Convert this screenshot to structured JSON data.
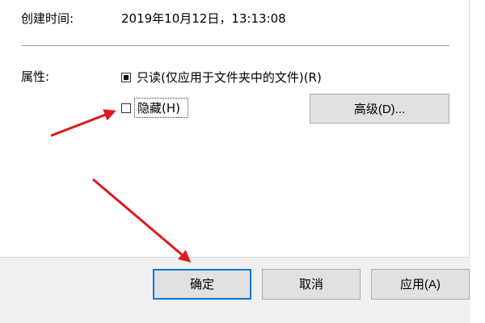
{
  "created": {
    "label": "创建时间:",
    "value": "2019年10月12日，13:13:08"
  },
  "attributes": {
    "label": "属性:",
    "readonly": {
      "label": "只读(仅应用于文件夹中的文件)(R)",
      "checked": "partial"
    },
    "hidden": {
      "label": "隐藏(H)",
      "checked": false
    },
    "advanced_button": "高级(D)..."
  },
  "buttons": {
    "ok": "确定",
    "cancel": "取消",
    "apply": "应用(A)"
  },
  "colors": {
    "arrow": "#e0191d",
    "dialog_bg": "#f0f0f0",
    "button_bg": "#e1e1e1",
    "default_button_border": "#0078d7"
  }
}
